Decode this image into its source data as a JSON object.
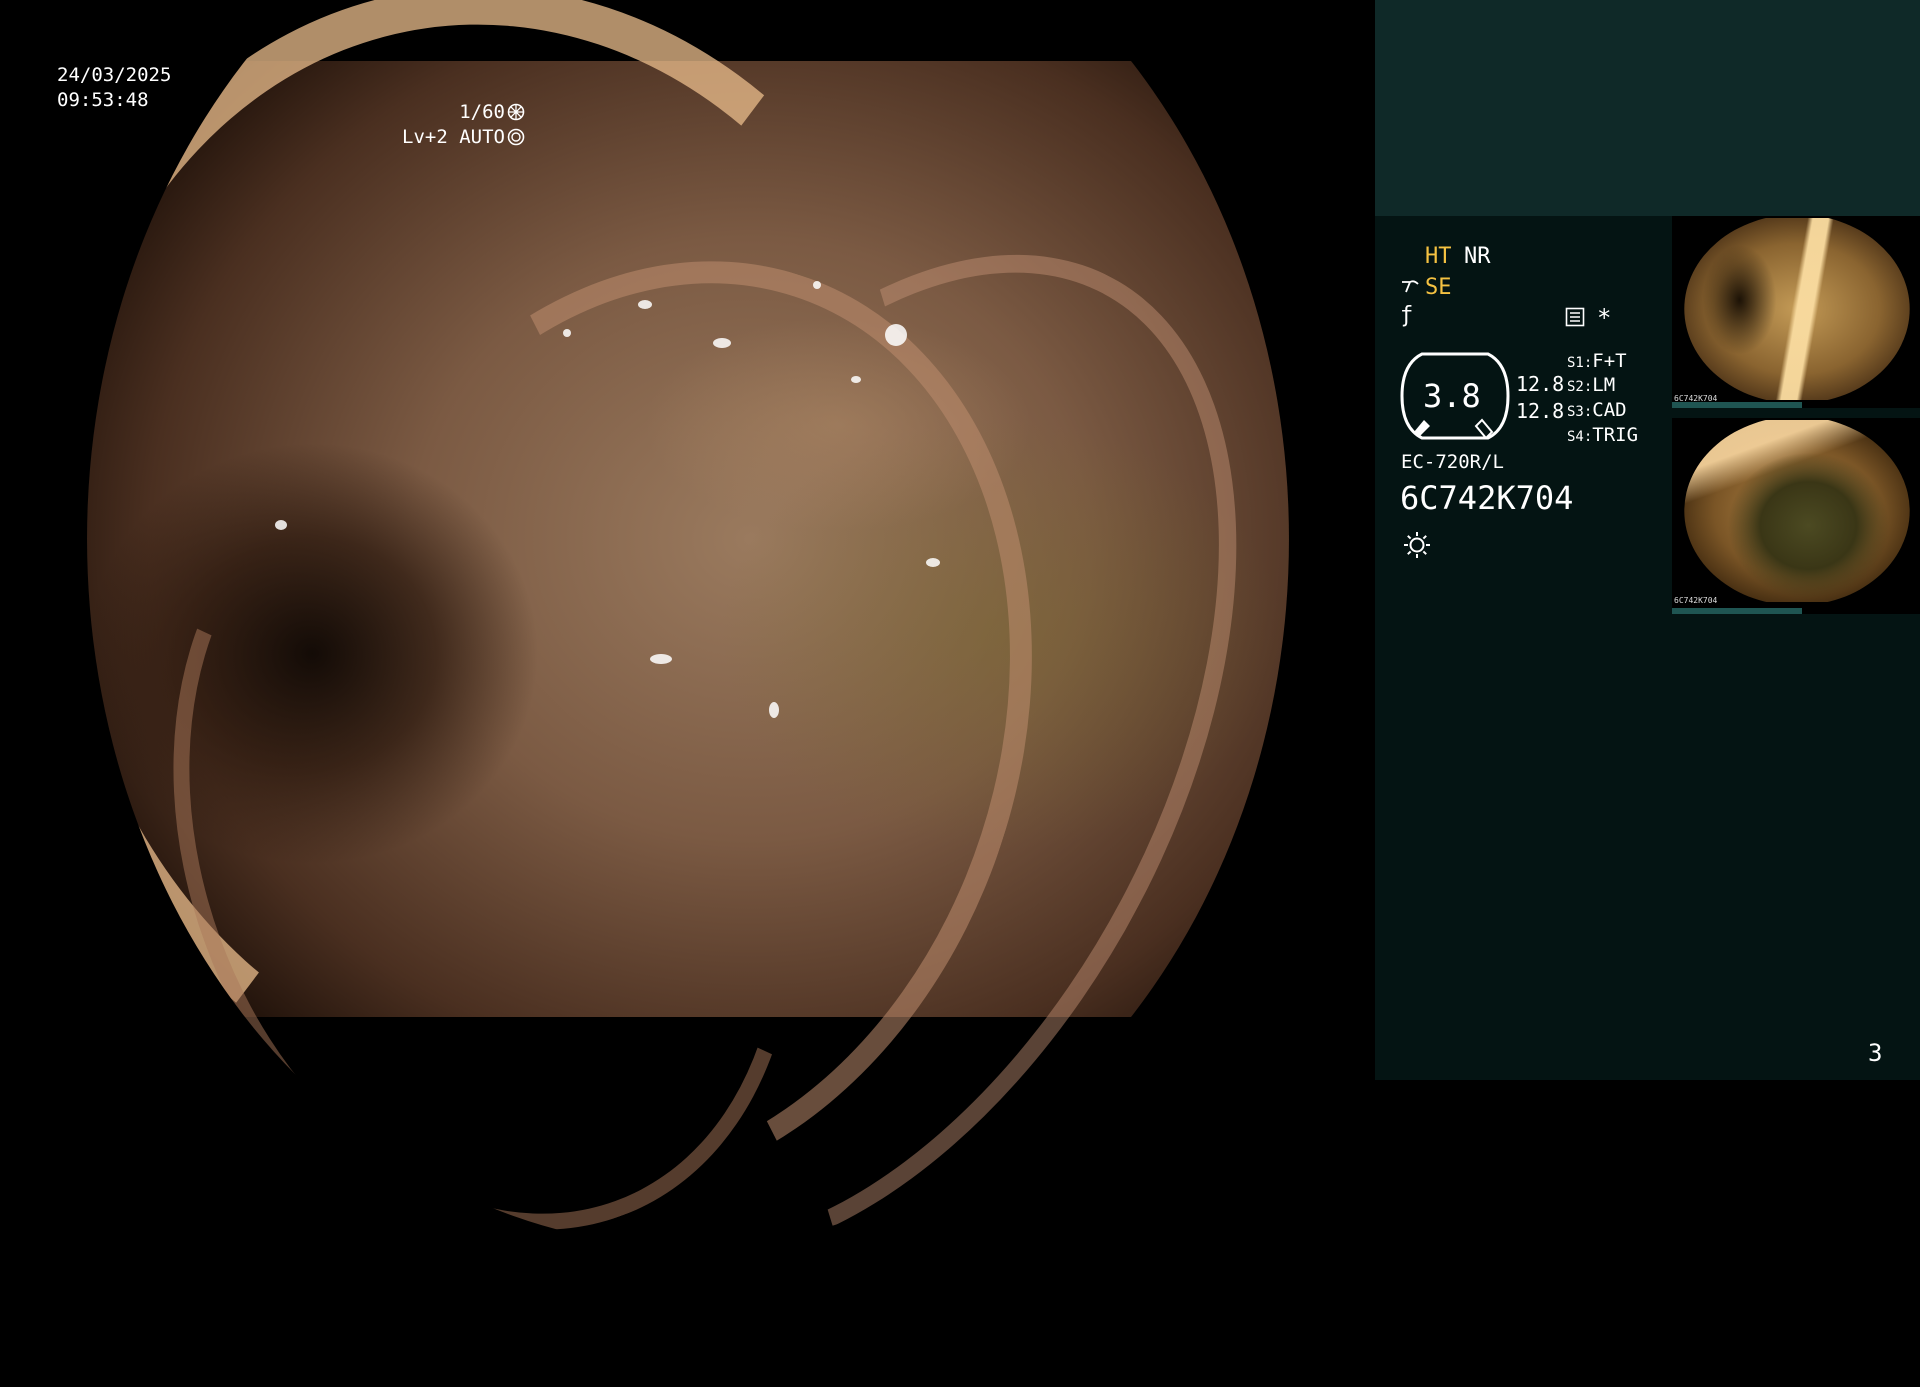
{
  "overlay": {
    "date": "24/03/2025",
    "time": "09:53:48",
    "shutter": "1/60",
    "level": "Lv+2 AUTO"
  },
  "panel": {
    "ht": "HT",
    "nr": "NR",
    "se": "SE",
    "star": "*",
    "zoom": "3.8",
    "value_1": "12.8",
    "value_2": "12.8",
    "switches": [
      {
        "key": "S1",
        "value": "F+T"
      },
      {
        "key": "S2",
        "value": "LM"
      },
      {
        "key": "S3",
        "value": "CAD"
      },
      {
        "key": "S4",
        "value": "TRIG"
      }
    ],
    "scope_model": "EC-720R/L",
    "serial": "6C742K704",
    "page_number": "3"
  },
  "thumbnails": [
    {
      "label": "6C742K704"
    },
    {
      "label": "6C742K704"
    }
  ],
  "colors": {
    "panel_bg": "#041413",
    "panel_top": "#0f2928",
    "accent_yellow": "#f5c242",
    "thumb_bar": "#1f5552"
  },
  "icons": [
    "shutter-icon",
    "auto-iris-icon",
    "se-icon",
    "f-icon",
    "enhancement-icon",
    "light-icon"
  ]
}
